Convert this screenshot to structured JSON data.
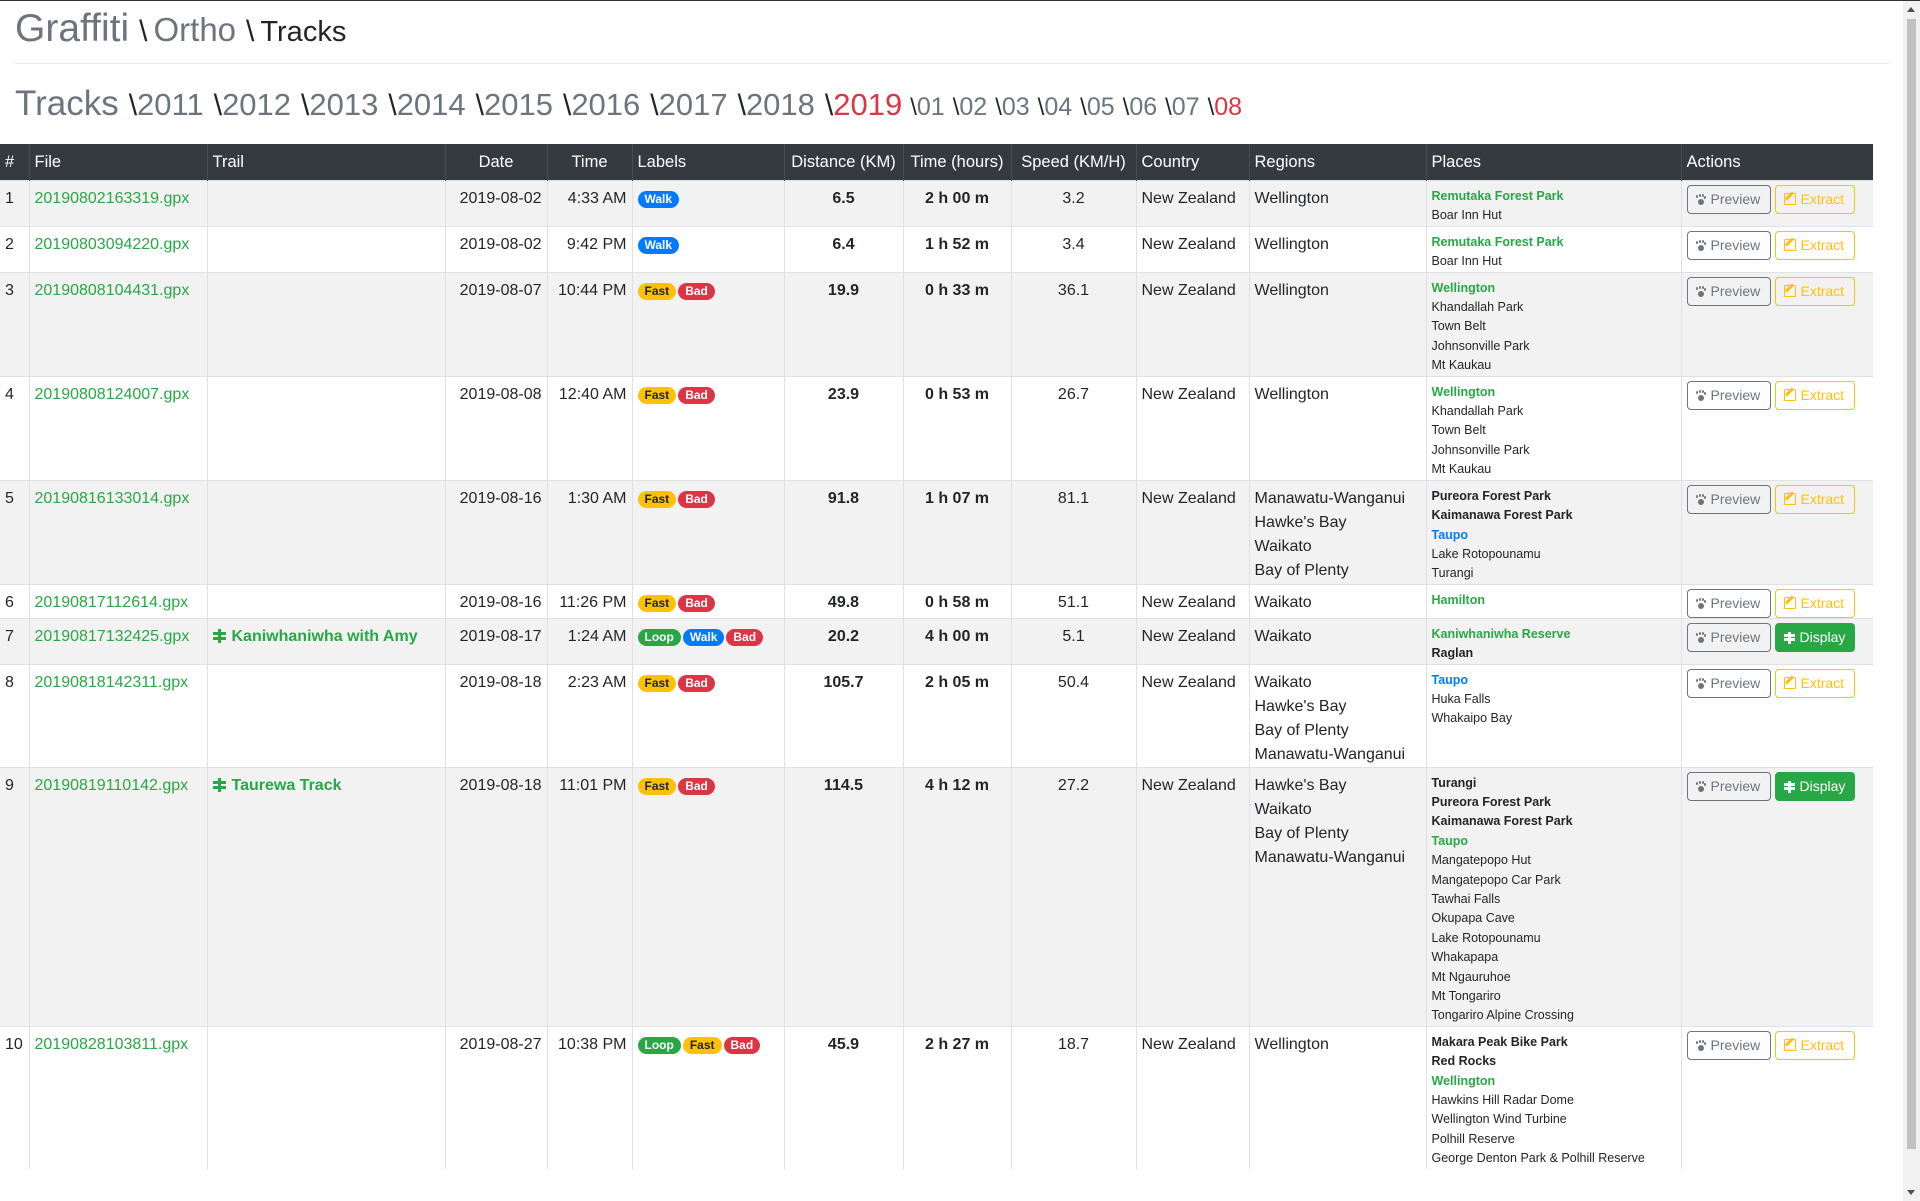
{
  "breadcrumb": {
    "brand": "Graffiti",
    "sep": "\\",
    "section": "Ortho",
    "current": "Tracks"
  },
  "years": {
    "title": "Tracks",
    "items": [
      "2011",
      "2012",
      "2013",
      "2014",
      "2015",
      "2016",
      "2017",
      "2018",
      "2019"
    ],
    "active_year": "2019",
    "months": [
      "01",
      "02",
      "03",
      "04",
      "05",
      "06",
      "07",
      "08"
    ],
    "active_month": "08"
  },
  "table": {
    "headers": [
      "#",
      "File",
      "Trail",
      "Date",
      "Time",
      "Labels",
      "Distance (KM)",
      "Time (hours)",
      "Speed (KM/H)",
      "Country",
      "Regions",
      "Places",
      "Actions"
    ],
    "preview_label": "Preview",
    "extract_label": "Extract",
    "display_label": "Display",
    "rows": [
      {
        "n": "1",
        "file": "20190802163319.gpx",
        "trail": "",
        "date": "2019-08-02",
        "time": "4:33 AM",
        "labels": [
          {
            "t": "Walk",
            "c": "blue"
          }
        ],
        "distance": "6.5",
        "duration": "2 h 00 m",
        "speed": "3.2",
        "country": "New Zealand",
        "regions": [
          "Wellington"
        ],
        "places": [
          {
            "t": "Remutaka Forest Park",
            "s": "green"
          },
          {
            "t": "Boar Inn Hut",
            "s": "plain"
          }
        ],
        "action": "extract"
      },
      {
        "n": "2",
        "file": "20190803094220.gpx",
        "trail": "",
        "date": "2019-08-02",
        "time": "9:42 PM",
        "labels": [
          {
            "t": "Walk",
            "c": "blue"
          }
        ],
        "distance": "6.4",
        "duration": "1 h 52 m",
        "speed": "3.4",
        "country": "New Zealand",
        "regions": [
          "Wellington"
        ],
        "places": [
          {
            "t": "Remutaka Forest Park",
            "s": "green"
          },
          {
            "t": "Boar Inn Hut",
            "s": "plain"
          }
        ],
        "action": "extract"
      },
      {
        "n": "3",
        "file": "20190808104431.gpx",
        "trail": "",
        "date": "2019-08-07",
        "time": "10:44 PM",
        "labels": [
          {
            "t": "Fast",
            "c": "yellow"
          },
          {
            "t": "Bad",
            "c": "red"
          }
        ],
        "distance": "19.9",
        "duration": "0 h 33 m",
        "speed": "36.1",
        "country": "New Zealand",
        "regions": [
          "Wellington"
        ],
        "places": [
          {
            "t": "Wellington",
            "s": "green"
          },
          {
            "t": "Khandallah Park",
            "s": "plain"
          },
          {
            "t": "Town Belt",
            "s": "plain"
          },
          {
            "t": "Johnsonville Park",
            "s": "plain"
          },
          {
            "t": "Mt Kaukau",
            "s": "plain"
          }
        ],
        "action": "extract"
      },
      {
        "n": "4",
        "file": "20190808124007.gpx",
        "trail": "",
        "date": "2019-08-08",
        "time": "12:40 AM",
        "labels": [
          {
            "t": "Fast",
            "c": "yellow"
          },
          {
            "t": "Bad",
            "c": "red"
          }
        ],
        "distance": "23.9",
        "duration": "0 h 53 m",
        "speed": "26.7",
        "country": "New Zealand",
        "regions": [
          "Wellington"
        ],
        "places": [
          {
            "t": "Wellington",
            "s": "green"
          },
          {
            "t": "Khandallah Park",
            "s": "plain"
          },
          {
            "t": "Town Belt",
            "s": "plain"
          },
          {
            "t": "Johnsonville Park",
            "s": "plain"
          },
          {
            "t": "Mt Kaukau",
            "s": "plain"
          }
        ],
        "action": "extract"
      },
      {
        "n": "5",
        "file": "20190816133014.gpx",
        "trail": "",
        "date": "2019-08-16",
        "time": "1:30 AM",
        "labels": [
          {
            "t": "Fast",
            "c": "yellow"
          },
          {
            "t": "Bad",
            "c": "red"
          }
        ],
        "distance": "91.8",
        "duration": "1 h 07 m",
        "speed": "81.1",
        "country": "New Zealand",
        "regions": [
          "Manawatu-Wanganui",
          "Hawke's Bay",
          "Waikato",
          "Bay of Plenty"
        ],
        "places": [
          {
            "t": "Pureora Forest Park",
            "s": "bold"
          },
          {
            "t": "Kaimanawa Forest Park",
            "s": "bold"
          },
          {
            "t": "Taupo",
            "s": "blue"
          },
          {
            "t": "Lake Rotopounamu",
            "s": "plain"
          },
          {
            "t": "Turangi",
            "s": "plain"
          }
        ],
        "action": "extract"
      },
      {
        "n": "6",
        "file": "20190817112614.gpx",
        "trail": "",
        "date": "2019-08-16",
        "time": "11:26 PM",
        "labels": [
          {
            "t": "Fast",
            "c": "yellow"
          },
          {
            "t": "Bad",
            "c": "red"
          }
        ],
        "distance": "49.8",
        "duration": "0 h 58 m",
        "speed": "51.1",
        "country": "New Zealand",
        "regions": [
          "Waikato"
        ],
        "places": [
          {
            "t": "Hamilton",
            "s": "green"
          }
        ],
        "action": "extract"
      },
      {
        "n": "7",
        "file": "20190817132425.gpx",
        "trail": "Kaniwhaniwha with Amy",
        "date": "2019-08-17",
        "time": "1:24 AM",
        "labels": [
          {
            "t": "Loop",
            "c": "green"
          },
          {
            "t": "Walk",
            "c": "blue"
          },
          {
            "t": "Bad",
            "c": "red"
          }
        ],
        "distance": "20.2",
        "duration": "4 h 00 m",
        "speed": "5.1",
        "country": "New Zealand",
        "regions": [
          "Waikato"
        ],
        "places": [
          {
            "t": "Kaniwhaniwha Reserve",
            "s": "green"
          },
          {
            "t": "Raglan",
            "s": "bold"
          }
        ],
        "action": "display"
      },
      {
        "n": "8",
        "file": "20190818142311.gpx",
        "trail": "",
        "date": "2019-08-18",
        "time": "2:23 AM",
        "labels": [
          {
            "t": "Fast",
            "c": "yellow"
          },
          {
            "t": "Bad",
            "c": "red"
          }
        ],
        "distance": "105.7",
        "duration": "2 h 05 m",
        "speed": "50.4",
        "country": "New Zealand",
        "regions": [
          "Waikato",
          "Hawke's Bay",
          "Bay of Plenty",
          "Manawatu-Wanganui"
        ],
        "places": [
          {
            "t": "Taupo",
            "s": "blue"
          },
          {
            "t": "Huka Falls",
            "s": "plain"
          },
          {
            "t": "Whakaipo Bay",
            "s": "plain"
          }
        ],
        "action": "extract"
      },
      {
        "n": "9",
        "file": "20190819110142.gpx",
        "trail": "Taurewa Track",
        "date": "2019-08-18",
        "time": "11:01 PM",
        "labels": [
          {
            "t": "Fast",
            "c": "yellow"
          },
          {
            "t": "Bad",
            "c": "red"
          }
        ],
        "distance": "114.5",
        "duration": "4 h 12 m",
        "speed": "27.2",
        "country": "New Zealand",
        "regions": [
          "Hawke's Bay",
          "Waikato",
          "Bay of Plenty",
          "Manawatu-Wanganui"
        ],
        "places": [
          {
            "t": "Turangi",
            "s": "bold"
          },
          {
            "t": "Pureora Forest Park",
            "s": "bold"
          },
          {
            "t": "Kaimanawa Forest Park",
            "s": "bold"
          },
          {
            "t": "Taupo",
            "s": "green"
          },
          {
            "t": "Mangatepopo Hut",
            "s": "plain"
          },
          {
            "t": "Mangatepopo Car Park",
            "s": "plain"
          },
          {
            "t": "Tawhai Falls",
            "s": "plain"
          },
          {
            "t": "Okupapa Cave",
            "s": "plain"
          },
          {
            "t": "Lake Rotopounamu",
            "s": "plain"
          },
          {
            "t": "Whakapapa",
            "s": "plain"
          },
          {
            "t": "Mt Ngauruhoe",
            "s": "plain"
          },
          {
            "t": "Mt Tongariro",
            "s": "plain"
          },
          {
            "t": "Tongariro Alpine Crossing",
            "s": "plain"
          }
        ],
        "action": "display"
      },
      {
        "n": "10",
        "file": "20190828103811.gpx",
        "trail": "",
        "date": "2019-08-27",
        "time": "10:38 PM",
        "labels": [
          {
            "t": "Loop",
            "c": "green"
          },
          {
            "t": "Fast",
            "c": "yellow"
          },
          {
            "t": "Bad",
            "c": "red"
          }
        ],
        "distance": "45.9",
        "duration": "2 h 27 m",
        "speed": "18.7",
        "country": "New Zealand",
        "regions": [
          "Wellington"
        ],
        "places": [
          {
            "t": "Makara Peak Bike Park",
            "s": "bold"
          },
          {
            "t": "Red Rocks",
            "s": "bold"
          },
          {
            "t": "Wellington",
            "s": "green"
          },
          {
            "t": "Hawkins Hill Radar Dome",
            "s": "plain"
          },
          {
            "t": "Wellington Wind Turbine",
            "s": "plain"
          },
          {
            "t": "Polhill Reserve",
            "s": "plain"
          },
          {
            "t": "George Denton Park & Polhill Reserve",
            "s": "plain"
          }
        ],
        "action": "extract"
      }
    ]
  }
}
